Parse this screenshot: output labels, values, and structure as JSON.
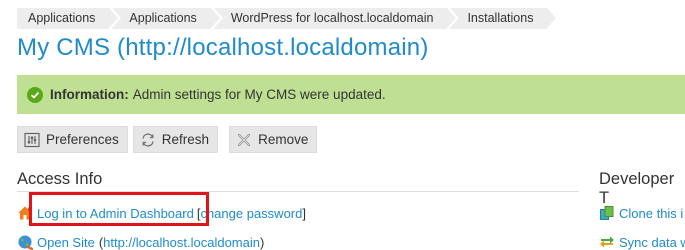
{
  "breadcrumb": [
    "Applications",
    "Applications",
    "WordPress for localhost.localdomain",
    "Installations"
  ],
  "page_title": "My CMS (http://localhost.localdomain)",
  "info_message": {
    "label": "Information:",
    "text": "Admin settings for My CMS were updated."
  },
  "toolbar": {
    "preferences": "Preferences",
    "refresh": "Refresh",
    "remove": "Remove"
  },
  "access_info": {
    "title": "Access Info",
    "login_link": "Log in to Admin Dashboard",
    "open_bracket": "[",
    "change_password": "change password",
    "close_bracket": "]",
    "open_site_link": "Open Site",
    "open_site_url": "(http://localhost.localdomain)"
  },
  "developer_tools": {
    "title": "Developer T",
    "clone_link": "Clone this i",
    "sync_link": "Sync data w"
  },
  "colors": {
    "accent": "#1f8bcb",
    "info_bg": "#bfe093",
    "highlight": "#e0141b"
  }
}
